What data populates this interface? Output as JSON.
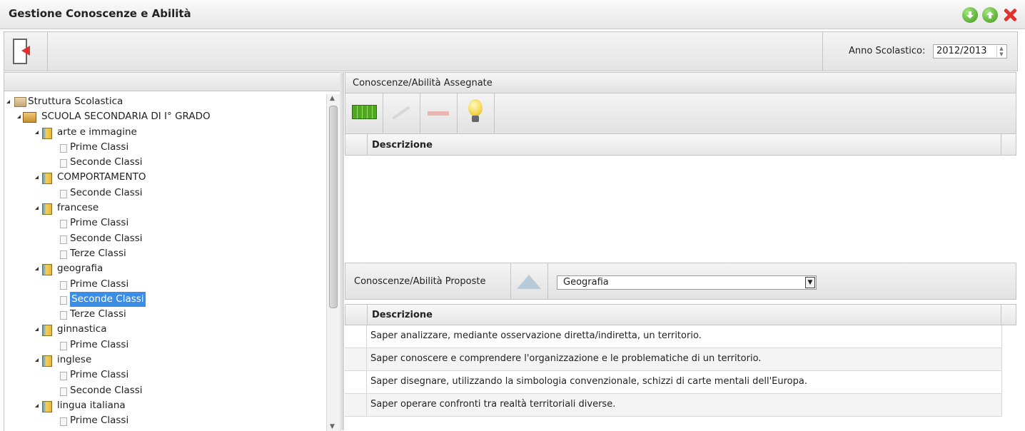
{
  "window": {
    "title": "Gestione Conoscenze e Abilità"
  },
  "toolbar": {
    "year_label": "Anno Scolastico:",
    "year_value": "2012/2013"
  },
  "tree": [
    {
      "label": "Struttura Scolastica",
      "level": 0,
      "icon": "building-icon",
      "expanded": true
    },
    {
      "label": "SCUOLA SECONDARIA DI I° GRADO",
      "level": 1,
      "icon": "school-icon",
      "expanded": true
    },
    {
      "label": "arte e immagine",
      "level": 2,
      "icon": "book-icon",
      "expanded": true
    },
    {
      "label": "Prime Classi",
      "level": 3,
      "icon": "page-icon"
    },
    {
      "label": "Seconde Classi",
      "level": 3,
      "icon": "page-icon"
    },
    {
      "label": "COMPORTAMENTO",
      "level": 2,
      "icon": "book-icon",
      "expanded": true
    },
    {
      "label": "Seconde Classi",
      "level": 3,
      "icon": "page-icon"
    },
    {
      "label": "francese",
      "level": 2,
      "icon": "book-icon",
      "expanded": true
    },
    {
      "label": "Prime Classi",
      "level": 3,
      "icon": "page-icon"
    },
    {
      "label": "Seconde Classi",
      "level": 3,
      "icon": "page-icon"
    },
    {
      "label": "Terze Classi",
      "level": 3,
      "icon": "page-icon"
    },
    {
      "label": "geografia",
      "level": 2,
      "icon": "book-icon",
      "expanded": true
    },
    {
      "label": "Prime Classi",
      "level": 3,
      "icon": "page-icon"
    },
    {
      "label": "Seconde Classi",
      "level": 3,
      "icon": "page-icon",
      "selected": true
    },
    {
      "label": "Terze Classi",
      "level": 3,
      "icon": "page-icon"
    },
    {
      "label": "ginnastica",
      "level": 2,
      "icon": "book-icon",
      "expanded": true
    },
    {
      "label": "Prime Classi",
      "level": 3,
      "icon": "page-icon"
    },
    {
      "label": "inglese",
      "level": 2,
      "icon": "book-icon",
      "expanded": true
    },
    {
      "label": "Prime Classi",
      "level": 3,
      "icon": "page-icon"
    },
    {
      "label": "Seconde Classi",
      "level": 3,
      "icon": "page-icon"
    },
    {
      "label": "lingua italiana",
      "level": 2,
      "icon": "book-icon",
      "expanded": true
    },
    {
      "label": "Prime Classi",
      "level": 3,
      "icon": "page-icon"
    }
  ],
  "assigned": {
    "header": "Conoscenze/Abilità Assegnate",
    "column": "Descrizione"
  },
  "proposed": {
    "label": "Conoscenze/Abilità Proposte",
    "subject": "Geografia",
    "column": "Descrizione",
    "rows": [
      "Saper analizzare, mediante osservazione diretta/indiretta, un territorio.",
      "Saper conoscere e comprendere l'organizzazione e le problematiche di un territorio.",
      "Saper disegnare, utilizzando la simbologia convenzionale, schizzi di carte mentali dell'Europa.",
      "Saper operare confronti tra realtà territoriali diverse."
    ]
  },
  "colors": {
    "selection": "#3a8ee6",
    "close": "#e0322c",
    "nav": "#3c9a18"
  }
}
